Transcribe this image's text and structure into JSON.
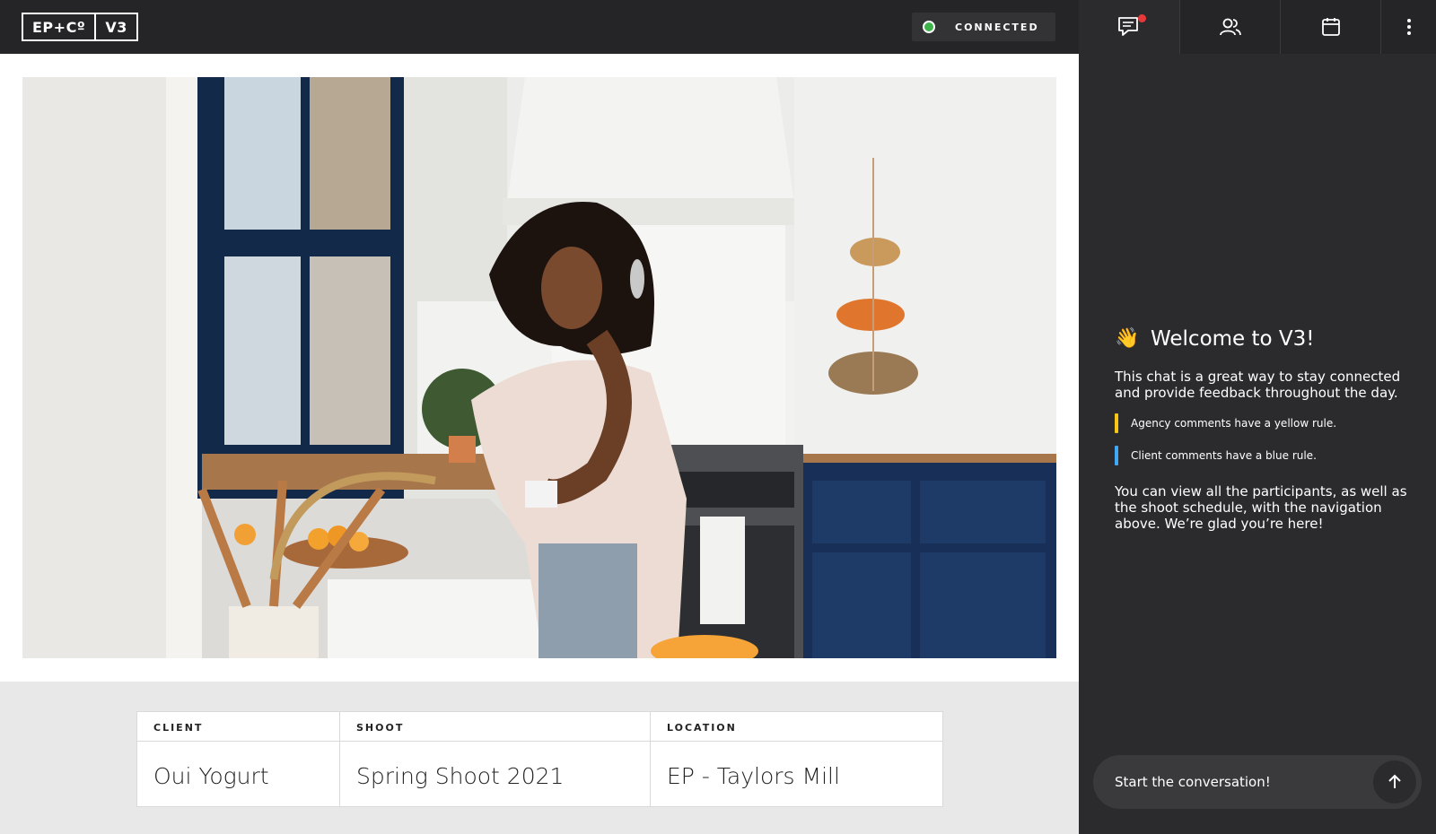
{
  "header": {
    "logo_left": "EP+Cº",
    "logo_right": "V3",
    "status_label": "CONNECTED",
    "status_color": "#3db34a"
  },
  "photo": {
    "icon": "kitchen-photo"
  },
  "info": {
    "columns": [
      {
        "label": "CLIENT",
        "value": "Oui Yogurt"
      },
      {
        "label": "SHOOT",
        "value": "Spring Shoot 2021"
      },
      {
        "label": "LOCATION",
        "value": "EP - Taylors Mill"
      }
    ]
  },
  "sidebar": {
    "tabs": [
      {
        "icon": "chat-icon",
        "active": true,
        "has_badge": true
      },
      {
        "icon": "participants-icon"
      },
      {
        "icon": "calendar-icon"
      },
      {
        "icon": "more-icon"
      }
    ],
    "welcome": {
      "emoji": "👋",
      "title": "Welcome to V3!",
      "intro": "This chat is a great way to stay connected and provide feedback throughout the day.",
      "agency_rule": "Agency comments have a yellow rule.",
      "client_rule": "Client comments have a blue rule.",
      "agency_color": "#f5c518",
      "client_color": "#3fa9f5",
      "outro": "You can view all the participants, as well as the shoot schedule, with the navigation above. We’re glad you’re here!"
    },
    "composer": {
      "placeholder": "Start the conversation!"
    }
  }
}
